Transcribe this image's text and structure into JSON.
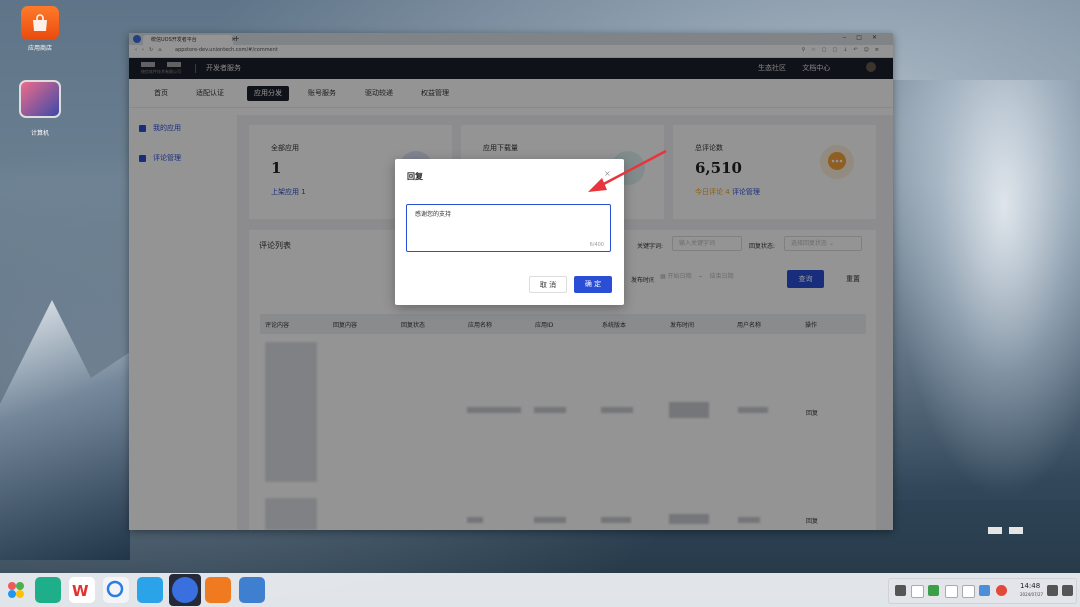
{
  "desktop": {
    "icons": [
      {
        "label": "应用商店"
      },
      {
        "label": "计算机"
      }
    ]
  },
  "browser": {
    "tab_title": "统信UOS开发者平台",
    "url": "appstore-dev.uniontech.com/#/comment"
  },
  "site": {
    "brand_caption": "统信软件技术有限公司",
    "name": "开发者服务",
    "right_links": [
      "生态社区",
      "文档中心"
    ],
    "nav": [
      "首页",
      "适配认证",
      "应用分发",
      "账号服务",
      "驱动较递",
      "权益管理"
    ],
    "nav_active": "应用分发",
    "sidebar": [
      "我的应用",
      "评论管理"
    ]
  },
  "cards": [
    {
      "title": "全部应用",
      "value": "1",
      "link_label": "上架应用",
      "link_value": "1"
    },
    {
      "title": "应用下载量",
      "value": ""
    },
    {
      "title": "总评论数",
      "value": "6,510",
      "link_label": "今日评论",
      "link_value": "4",
      "link_extra": "评论管理"
    }
  ],
  "list": {
    "title": "评论列表",
    "filters": {
      "keyword_label": "关键字词:",
      "keyword_placeholder": "输入关键字词",
      "reply_label": "回复状态:",
      "reply_placeholder": "选择回复状态",
      "time_label": "发布时间:",
      "start_placeholder": "开始日期",
      "range_sep": "-",
      "end_placeholder": "结束日期",
      "query_button": "查询",
      "reset_button": "重置"
    },
    "columns": [
      "评论内容",
      "回复内容",
      "回复状态",
      "应用名称",
      "应用ID",
      "系统版本",
      "发布时间",
      "用户名称",
      "操作"
    ],
    "row_action": "回复"
  },
  "dialog": {
    "title": "回复",
    "content": "感谢您的支持",
    "count": "6/400",
    "cancel": "取 消",
    "ok": "确 定"
  },
  "taskbar": {
    "time": "14:48",
    "date": "2024/07/27"
  },
  "colors": {
    "accent": "#2a4fd6",
    "header_bg": "#1c1f2b",
    "warn": "#f0a020",
    "arrow": "#e8343c"
  }
}
